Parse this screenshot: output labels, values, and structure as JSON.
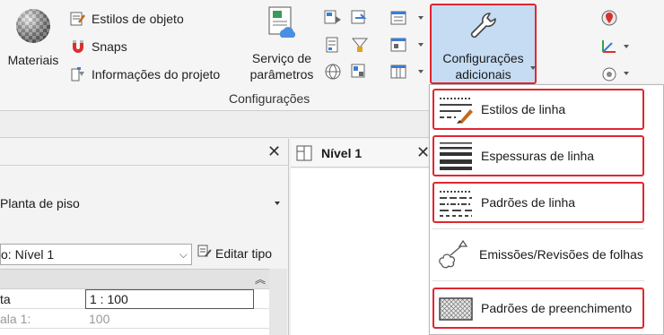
{
  "ribbon": {
    "materials_label": "Materiais",
    "object_styles_label": "Estilos de  objeto",
    "snaps_label": "Snaps",
    "project_info_label": "Informações do  projeto",
    "param_service_label_1": "Serviço de",
    "param_service_label_2": "parâmetros",
    "additional_settings_label_1": "Configurações",
    "additional_settings_label_2": "adicionais",
    "panel_title": "Configurações"
  },
  "properties": {
    "type_name": "Planta de piso",
    "filter_value": "o: Nível 1",
    "edit_type_label": "Editar tipo",
    "rows": [
      {
        "name": "ta",
        "value": "1 : 100"
      },
      {
        "name": "ala    1:",
        "value": "100"
      }
    ]
  },
  "view_tab": {
    "title": "Nível 1"
  },
  "menu": {
    "items": [
      {
        "label": "Estilos de linha",
        "icon": "line-styles-icon"
      },
      {
        "label": "Espessuras de linha",
        "icon": "line-weights-icon"
      },
      {
        "label": "Padrões de linha",
        "icon": "line-patterns-icon"
      },
      {
        "label": "Emissões/Revisões de folhas",
        "icon": "sheet-issues-icon"
      },
      {
        "label": "Padrões de preenchimento",
        "icon": "fill-patterns-icon"
      }
    ]
  },
  "colors": {
    "highlight_border": "#e0262f",
    "selected_button": "#c5dcf3"
  }
}
